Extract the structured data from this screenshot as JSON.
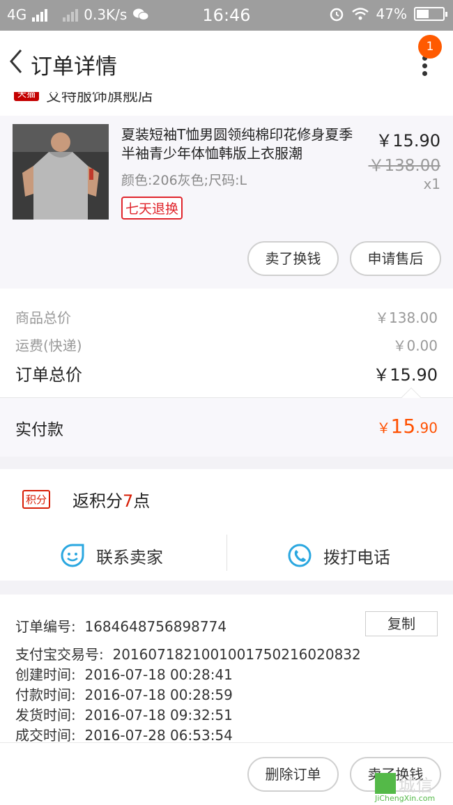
{
  "status_bar": {
    "network": "4G",
    "speed": "0.3K/s",
    "time": "16:46",
    "battery": "47%",
    "battery_level": 0.47,
    "icons": [
      "signal-icon",
      "wechat-icon",
      "alarm-icon",
      "wifi-icon",
      "battery-icon"
    ]
  },
  "nav": {
    "title": "订单详情",
    "badge_count": "1"
  },
  "shop": {
    "tag": "天猫",
    "name": "艾特服饰旗舰店"
  },
  "item": {
    "name": "夏装短袖T恤男圆领纯棉印花修身夏季半袖青少年体恤韩版上衣服潮",
    "spec": "颜色:206灰色;尺码:L",
    "service_tag": "七天退换",
    "price": "￥15.90",
    "original_price": "￥138.00",
    "quantity": "x1",
    "actions": [
      "卖了换钱",
      "申请售后"
    ]
  },
  "summary": {
    "goods_total_label": "商品总价",
    "goods_total_value": "￥138.00",
    "shipping_label": "运费(快递)",
    "shipping_value": "￥0.00",
    "order_total_label": "订单总价",
    "order_total_value": "￥15.90"
  },
  "paid": {
    "label": "实付款",
    "currency": "￥",
    "integer": "15",
    "decimal": ".90",
    "color": "#ff5000"
  },
  "points": {
    "badge": "积分",
    "text_prefix": "返积分",
    "amount": "7",
    "text_suffix": "点"
  },
  "contact": {
    "seller_label": "联系卖家",
    "call_label": "拨打电话",
    "icon_color": "#2aa7e0"
  },
  "order_info": {
    "copy_label": "复制",
    "rows": [
      {
        "label": "订单编号:",
        "value": "1684648756898774"
      },
      {
        "label": "支付宝交易号:",
        "value": "2016071821001001750216020832"
      },
      {
        "label": "创建时间:",
        "value": "2016-07-18 00:28:41"
      },
      {
        "label": "付款时间:",
        "value": "2016-07-18 00:28:59"
      },
      {
        "label": "发货时间:",
        "value": "2016-07-18 09:32:51"
      },
      {
        "label": "成交时间:",
        "value": "2016-07-28 06:53:54"
      }
    ]
  },
  "footer": {
    "delete_label": "删除订单",
    "sell_label": "卖了换钱"
  },
  "watermark": {
    "brand": "城信",
    "url": "JiChengXin.com"
  }
}
